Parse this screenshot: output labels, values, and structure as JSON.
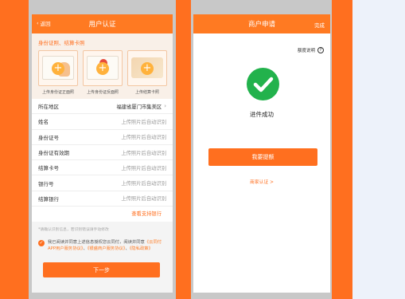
{
  "colors": {
    "accent": "#ff6f1f",
    "success": "#22b24c",
    "panel_bg": "#edf2fa"
  },
  "screen1": {
    "back_label": "返回",
    "title": "用户认证",
    "section_title": "身份证照、结算卡照",
    "cards": [
      {
        "caption": "上传身份证正面照"
      },
      {
        "caption": "上传身份证反面照"
      },
      {
        "caption": "上传结算卡照"
      }
    ],
    "rows": [
      {
        "label": "所在地区",
        "value": "福建省厦门市集美区"
      },
      {
        "label": "姓名",
        "value": "上传照片后自动识别"
      },
      {
        "label": "身份证号",
        "value": "上传照片后自动识别"
      },
      {
        "label": "身份证有效期",
        "value": "上传照片后自动识别"
      },
      {
        "label": "结算卡号",
        "value": "上传照片后自动识别"
      },
      {
        "label": "银行号",
        "value": "上传照片后自动识别"
      },
      {
        "label": "结算银行",
        "value": "上传照片后自动识别"
      }
    ],
    "banks_link": "查看支持银行",
    "note": "*请确认识别信息，若识别错误请手动修改",
    "agreement": {
      "text": "我已阅读并同意上述信息授权您云同付，阅读并同意",
      "links": [
        "《云同付APP用户服务协议》",
        "《银盛商户服务协议》",
        "《隐私政策》"
      ]
    },
    "next_button": "下一步"
  },
  "screen2": {
    "title": "商户申请",
    "done_label": "完成",
    "help_label": "额度说明",
    "status_text": "进件成功",
    "submit_button": "我要提额",
    "merchant_link": "商家认证 >"
  }
}
